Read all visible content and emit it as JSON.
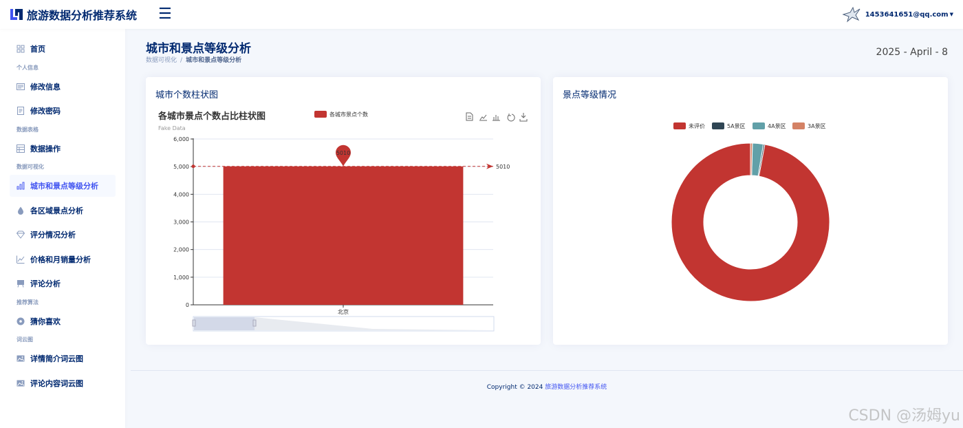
{
  "app": {
    "title": "旅游数据分析推荐系统",
    "user_email": "1453641651@qq.com"
  },
  "sidebar": {
    "items": [
      {
        "type": "item",
        "label": "首页",
        "icon": "grid-icon",
        "active": false
      },
      {
        "type": "heading",
        "label": "个人信息"
      },
      {
        "type": "item",
        "label": "修改信息",
        "icon": "id-card-icon",
        "active": false
      },
      {
        "type": "item",
        "label": "修改密码",
        "icon": "document-icon",
        "active": false
      },
      {
        "type": "heading",
        "label": "数据表格"
      },
      {
        "type": "item",
        "label": "数据操作",
        "icon": "table-icon",
        "active": false
      },
      {
        "type": "heading",
        "label": "数据可视化"
      },
      {
        "type": "item",
        "label": "城市和景点等级分析",
        "icon": "bar-chart-icon",
        "active": true
      },
      {
        "type": "item",
        "label": "各区域景点分析",
        "icon": "droplet-icon",
        "active": false
      },
      {
        "type": "item",
        "label": "评分情况分析",
        "icon": "gem-icon",
        "active": false
      },
      {
        "type": "item",
        "label": "价格和月销量分析",
        "icon": "line-chart-icon",
        "active": false
      },
      {
        "type": "item",
        "label": "评论分析",
        "icon": "easel-icon",
        "active": false
      },
      {
        "type": "heading",
        "label": "推荐算法"
      },
      {
        "type": "item",
        "label": "猜你喜欢",
        "icon": "vinyl-icon",
        "active": false
      },
      {
        "type": "heading",
        "label": "词云图"
      },
      {
        "type": "item",
        "label": "详情简介词云图",
        "icon": "image-icon",
        "active": false
      },
      {
        "type": "item",
        "label": "评论内容词云图",
        "icon": "image-icon",
        "active": false
      }
    ]
  },
  "page": {
    "title": "城市和景点等级分析",
    "breadcrumb": [
      "数据可视化",
      "城市和景点等级分析"
    ],
    "breadcrumb_sep": "/",
    "date": "2025 - April - 8"
  },
  "bar_card": {
    "title": "城市个数柱状图"
  },
  "pie_card": {
    "title": "景点等级情况"
  },
  "footer": {
    "prefix": "Copyright © 2024 ",
    "link": "旅游数据分析推荐系统"
  },
  "watermark": "CSDN @汤姆yu",
  "colors": {
    "accent": "#4154f1",
    "navy": "#012970",
    "bar": "#c23531",
    "slate": "#2f4554",
    "teal": "#61a0a8",
    "salmon": "#d48265"
  },
  "chart_data": [
    {
      "type": "bar",
      "title": "各城市景点个数占比柱状图",
      "subtitle": "Fake Data",
      "legend": [
        "各城市景点个数"
      ],
      "categories": [
        "北京"
      ],
      "series": [
        {
          "name": "各城市景点个数",
          "values": [
            5010
          ]
        }
      ],
      "ylim": [
        0,
        6000
      ],
      "yticks": [
        0,
        1000,
        2000,
        3000,
        4000,
        5000,
        6000
      ],
      "ytick_labels": [
        "0",
        "1,000",
        "2,000",
        "3,000",
        "4,000",
        "5,000",
        "6,000"
      ],
      "markpoint": {
        "value": 5010,
        "label": "5010"
      },
      "markline": {
        "value": 5010,
        "label": "5010"
      },
      "grid": true,
      "legend_position": "top-center",
      "toolbox": [
        "data-view-icon",
        "line-switch-icon",
        "bar-switch-icon",
        "restore-icon",
        "save-icon"
      ]
    },
    {
      "type": "pie",
      "style": "donut",
      "legend": [
        "未评价",
        "5A景区",
        "4A景区",
        "3A景区"
      ],
      "slices": [
        {
          "name": "未评价",
          "value": 97.1
        },
        {
          "name": "5A景区",
          "value": 0.3
        },
        {
          "name": "4A景区",
          "value": 2.2
        },
        {
          "name": "3A景区",
          "value": 0.4
        }
      ],
      "legend_position": "top-center"
    }
  ]
}
